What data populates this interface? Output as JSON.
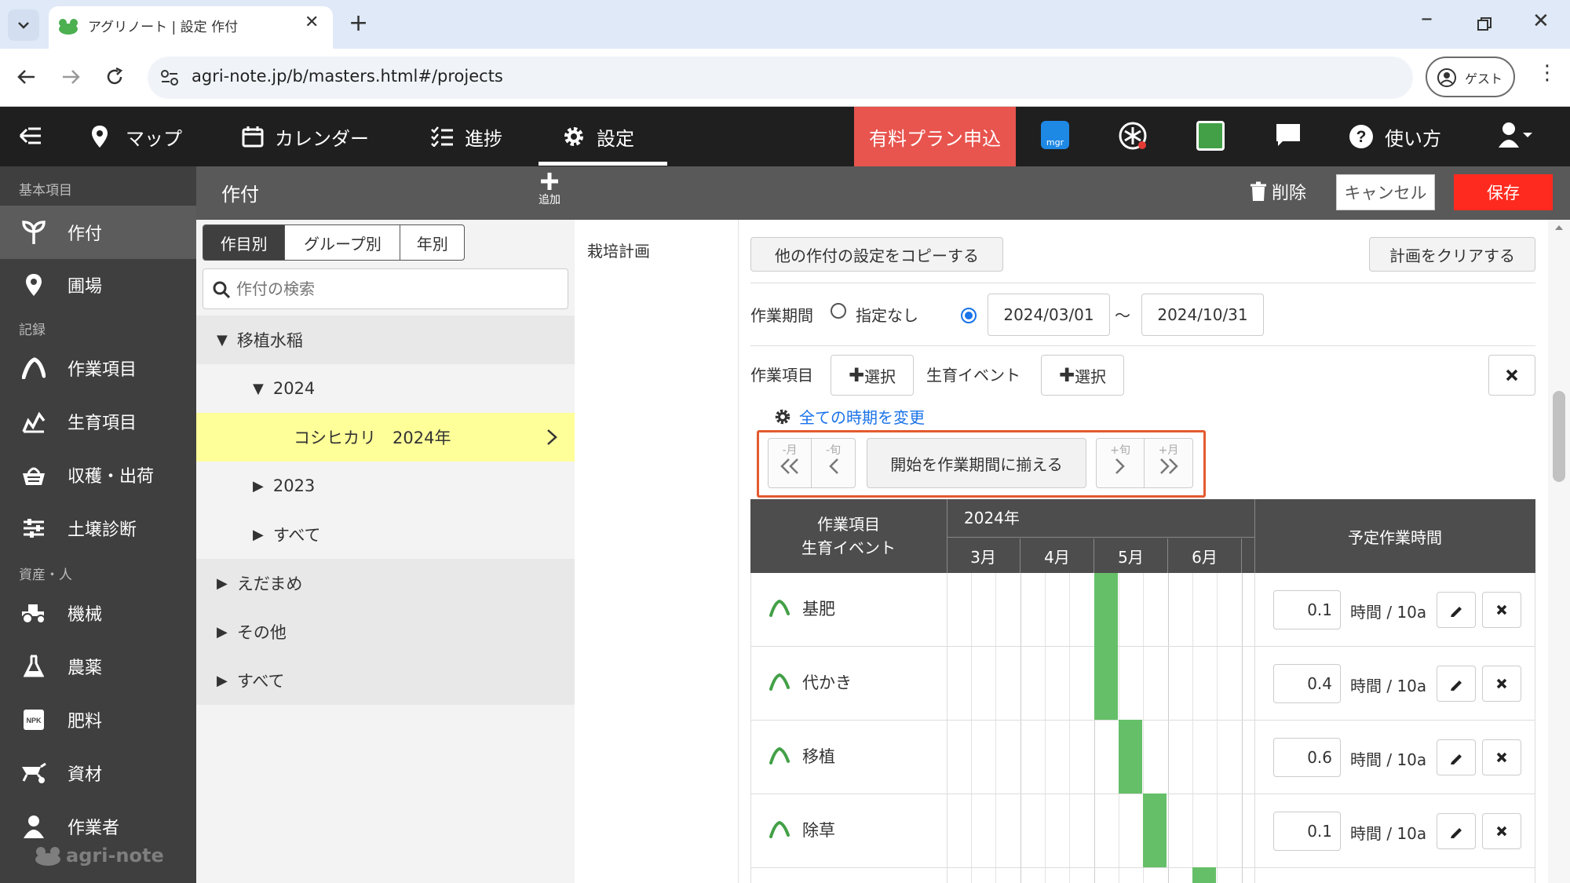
{
  "browser": {
    "tab_title": "アグリノート | 設定 作付",
    "url": "agri-note.jp/b/masters.html#/projects",
    "guest_label": "ゲスト"
  },
  "topnav": {
    "items": [
      "マップ",
      "カレンダー",
      "進捗",
      "設定"
    ],
    "trial": "有料プラン申込",
    "help": "使い方",
    "mgr": "mgr"
  },
  "sidebar": {
    "section_basic": "基本項目",
    "section_record": "記録",
    "section_asset": "資産・人",
    "items": [
      "作付",
      "圃場",
      "作業項目",
      "生育項目",
      "収穫・出荷",
      "土壌診断",
      "機械",
      "農薬",
      "肥料",
      "資材",
      "作業者"
    ],
    "logo": "agri-note"
  },
  "subhead": {
    "title": "作付",
    "add": "追加",
    "delete": "削除",
    "cancel": "キャンセル",
    "save": "保存"
  },
  "list": {
    "tabs": [
      "作目別",
      "グループ別",
      "年別"
    ],
    "search_placeholder": "作付の検索",
    "tree": [
      "移植水稲",
      "2024",
      "コシヒカリ　2024年",
      "2023",
      "すべて",
      "えだまめ",
      "その他",
      "すべて"
    ]
  },
  "plan": {
    "label": "栽培計画",
    "copy_btn": "他の作付の設定をコピーする",
    "clear_btn": "計画をクリアする",
    "period_label": "作業期間",
    "none_label": "指定なし",
    "start": "2024/03/01",
    "end": "2024/10/31",
    "tilde": "～",
    "task_label": "作業項目",
    "select": "選択",
    "event_label": "生育イベント",
    "change_all": "全ての時期を変更",
    "nav": {
      "prev_month": "-月",
      "prev_dekad": "-旬",
      "align": "開始を作業期間に揃える",
      "next_dekad": "+旬",
      "next_month": "+月"
    }
  },
  "table": {
    "head1": "作業項目",
    "head2": "生育イベント",
    "year": "2024年",
    "months": [
      "3月",
      "4月",
      "5月",
      "6月"
    ],
    "time_head": "予定作業時間",
    "unit": "時間 / 10a",
    "rows": [
      {
        "name": "基肥",
        "time": "0.1"
      },
      {
        "name": "代かき",
        "time": "0.4"
      },
      {
        "name": "移植",
        "time": "0.6"
      },
      {
        "name": "除草",
        "time": "0.1"
      }
    ]
  }
}
